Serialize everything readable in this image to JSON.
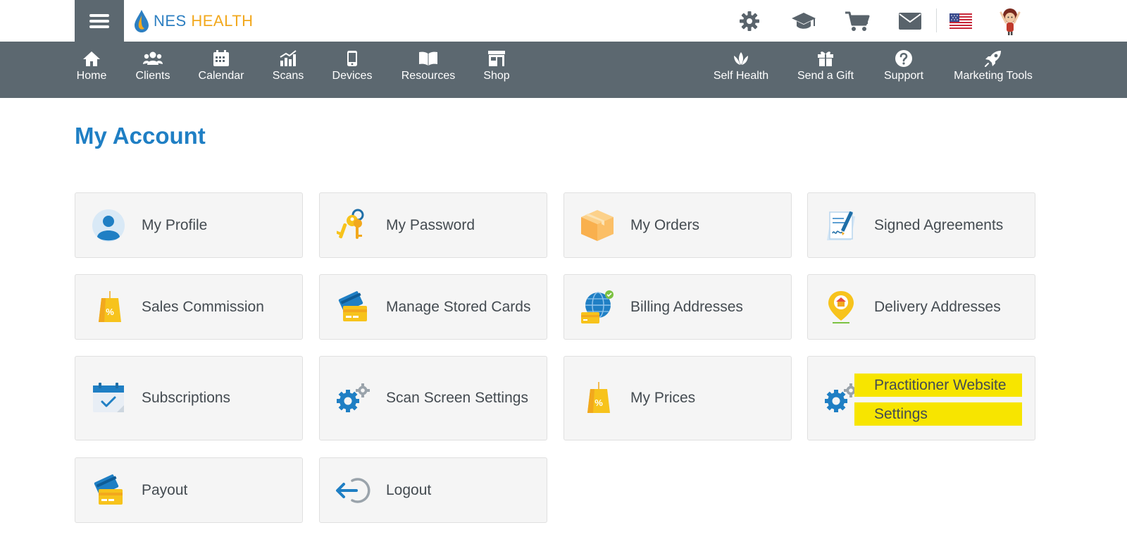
{
  "brand": {
    "name_part1": "NES",
    "name_part2": "HEALTH"
  },
  "top_icons": [
    "gear-icon",
    "graduation-cap-icon",
    "cart-icon",
    "mail-icon",
    "us-flag-icon",
    "avatar"
  ],
  "nav": {
    "left": [
      {
        "label": "Home",
        "icon": "home-icon"
      },
      {
        "label": "Clients",
        "icon": "clients-icon"
      },
      {
        "label": "Calendar",
        "icon": "calendar-icon"
      },
      {
        "label": "Scans",
        "icon": "scans-icon"
      },
      {
        "label": "Devices",
        "icon": "devices-icon"
      },
      {
        "label": "Resources",
        "icon": "book-icon"
      },
      {
        "label": "Shop",
        "icon": "shop-icon"
      }
    ],
    "right": [
      {
        "label": "Self Health",
        "icon": "lotus-icon"
      },
      {
        "label": "Send a Gift",
        "icon": "gift-icon"
      },
      {
        "label": "Support",
        "icon": "question-icon"
      },
      {
        "label": "Marketing Tools",
        "icon": "rocket-icon"
      }
    ]
  },
  "page": {
    "title": "My Account"
  },
  "cards": [
    {
      "label": "My Profile",
      "icon": "profile-icon"
    },
    {
      "label": "My Password",
      "icon": "keys-icon"
    },
    {
      "label": "My Orders",
      "icon": "box-icon"
    },
    {
      "label": "Signed Agreements",
      "icon": "signed-document-icon"
    },
    {
      "label": "Sales Commission",
      "icon": "price-tag-icon"
    },
    {
      "label": "Manage Stored Cards",
      "icon": "cards-icon"
    },
    {
      "label": "Billing Addresses",
      "icon": "globe-card-icon"
    },
    {
      "label": "Delivery Addresses",
      "icon": "location-pin-icon"
    },
    {
      "label": "Subscriptions",
      "icon": "calendar-check-icon"
    },
    {
      "label": "Scan Screen Settings",
      "icon": "gears-icon"
    },
    {
      "label": "My Prices",
      "icon": "price-tag-icon"
    },
    {
      "label_line1": "Practitioner Website",
      "label_line2": "Settings",
      "icon": "gears-icon",
      "highlighted": true
    },
    {
      "label": "Payout",
      "icon": "cards-icon"
    },
    {
      "label": "Logout",
      "icon": "logout-icon"
    }
  ],
  "colors": {
    "nav_bg": "#5c6870",
    "title_blue": "#1f7fc4",
    "card_bg": "#f5f5f5",
    "highlight": "#f7e500"
  }
}
